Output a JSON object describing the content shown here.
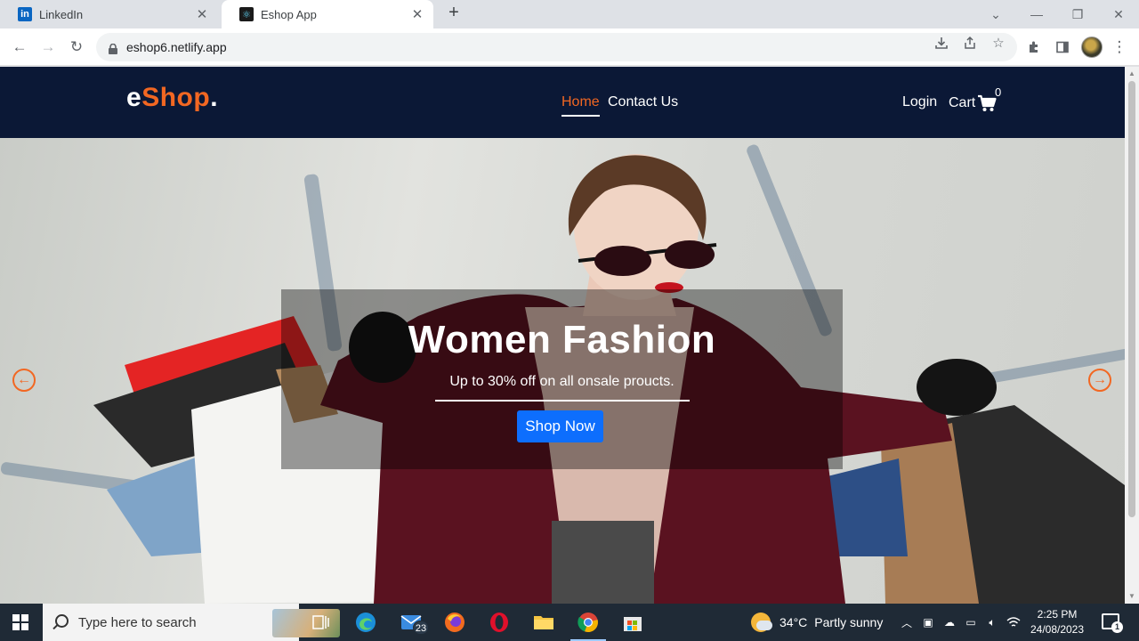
{
  "browser": {
    "tabs": [
      {
        "title": "LinkedIn",
        "active": false
      },
      {
        "title": "Eshop App",
        "active": true
      }
    ],
    "url": "eshop6.netlify.app"
  },
  "site": {
    "logo_main": "e",
    "logo_accent": "Shop",
    "logo_dot": ".",
    "nav": {
      "home": "Home",
      "contact": "Contact Us",
      "login": "Login",
      "cart": "Cart",
      "cart_count": "0"
    },
    "hero": {
      "title": "Women Fashion",
      "subtitle": "Up to 30% off on all onsale proucts.",
      "button": "Shop Now"
    },
    "colors": {
      "navbar": "#0b1836",
      "accent": "#f26722",
      "button": "#0d6efd"
    }
  },
  "taskbar": {
    "search_placeholder": "Type here to search",
    "mail_badge": "23",
    "weather_temp": "34°C",
    "weather_desc": "Partly sunny",
    "time": "2:25 PM",
    "date": "24/08/2023",
    "notification_count": "1"
  }
}
